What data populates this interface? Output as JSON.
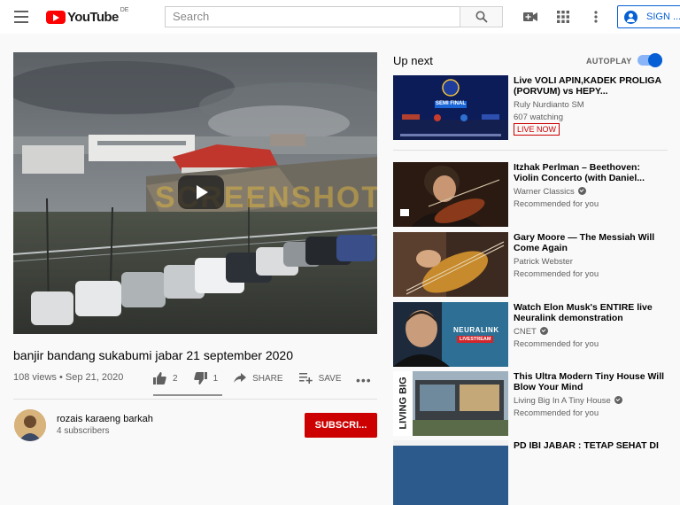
{
  "header": {
    "logo_text": "YouTube",
    "country_code": "DE",
    "search_placeholder": "Search",
    "signin_label": "SIGN ..."
  },
  "video": {
    "title": "banjir bandang sukabumi jabar 21 september 2020",
    "meta": "108 views • Sep 21, 2020",
    "likes": "2",
    "dislikes": "1",
    "share_label": "SHARE",
    "save_label": "SAVE",
    "more_label": "•••",
    "watermark": "SCREENSHOT"
  },
  "channel": {
    "name": "rozais karaeng barkah",
    "subscribers": "4 subscribers",
    "subscribe_label": "SUBSCRI..."
  },
  "sidebar": {
    "up_next_label": "Up next",
    "autoplay_label": "AUTOPLAY",
    "autoplay_on": true,
    "items": [
      {
        "title": "Live VOLI APIN,KADEK PROLIGA (PORVUM) vs HEPY...",
        "channel": "Ruly Nurdianto SM",
        "sub": "607 watching",
        "badge": "LIVE NOW",
        "thumb_text": "SEMI FINAL"
      },
      {
        "title": "Itzhak Perlman – Beethoven: Violin Concerto (with Daniel...",
        "channel": "Warner Classics",
        "sub": "Recommended for you"
      },
      {
        "title": "Gary Moore — The Messiah Will Come Again",
        "channel": "Patrick Webster",
        "sub": "Recommended for you"
      },
      {
        "title": "Watch Elon Musk's ENTIRE live Neuralink demonstration",
        "channel": "CNET",
        "sub": "Recommended for you",
        "thumb_text": "NEURALINK",
        "thumb_badge": "LIVESTREAM"
      },
      {
        "title": "This Ultra Modern Tiny House Will Blow Your Mind",
        "channel": "Living Big In A Tiny House",
        "sub": "Recommended for you",
        "thumb_text": "LIVING BIG"
      },
      {
        "title": "PD IBI JABAR : TETAP SEHAT DI"
      }
    ]
  }
}
